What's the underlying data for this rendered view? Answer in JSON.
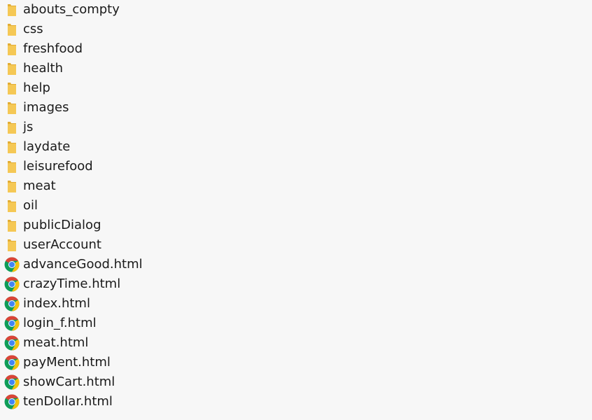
{
  "items": [
    {
      "name": "abouts_compty",
      "kind": "folder",
      "icon": "folder-icon"
    },
    {
      "name": "css",
      "kind": "folder",
      "icon": "folder-icon"
    },
    {
      "name": "freshfood",
      "kind": "folder",
      "icon": "folder-icon"
    },
    {
      "name": "health",
      "kind": "folder",
      "icon": "folder-icon"
    },
    {
      "name": "help",
      "kind": "folder",
      "icon": "folder-icon"
    },
    {
      "name": "images",
      "kind": "folder",
      "icon": "folder-icon"
    },
    {
      "name": "js",
      "kind": "folder",
      "icon": "folder-icon"
    },
    {
      "name": "laydate",
      "kind": "folder",
      "icon": "folder-icon"
    },
    {
      "name": "leisurefood",
      "kind": "folder",
      "icon": "folder-icon"
    },
    {
      "name": "meat",
      "kind": "folder",
      "icon": "folder-icon"
    },
    {
      "name": "oil",
      "kind": "folder",
      "icon": "folder-icon"
    },
    {
      "name": "publicDialog",
      "kind": "folder",
      "icon": "folder-icon"
    },
    {
      "name": "userAccount",
      "kind": "folder",
      "icon": "folder-icon"
    },
    {
      "name": "advanceGood.html",
      "kind": "html",
      "icon": "chrome-icon"
    },
    {
      "name": "crazyTime.html",
      "kind": "html",
      "icon": "chrome-icon"
    },
    {
      "name": "index.html",
      "kind": "html",
      "icon": "chrome-icon"
    },
    {
      "name": "login_f.html",
      "kind": "html",
      "icon": "chrome-icon"
    },
    {
      "name": "meat.html",
      "kind": "html",
      "icon": "chrome-icon"
    },
    {
      "name": "payMent.html",
      "kind": "html",
      "icon": "chrome-icon"
    },
    {
      "name": "showCart.html",
      "kind": "html",
      "icon": "chrome-icon"
    },
    {
      "name": "tenDollar.html",
      "kind": "html",
      "icon": "chrome-icon"
    }
  ],
  "colors": {
    "background": "#f7f7f7",
    "folder": "#f5c855",
    "folder_dark": "#e2ad35",
    "chrome_red": "#db4437",
    "chrome_yellow": "#f4c20d",
    "chrome_green": "#0f9d58",
    "chrome_blue": "#4285f4"
  }
}
